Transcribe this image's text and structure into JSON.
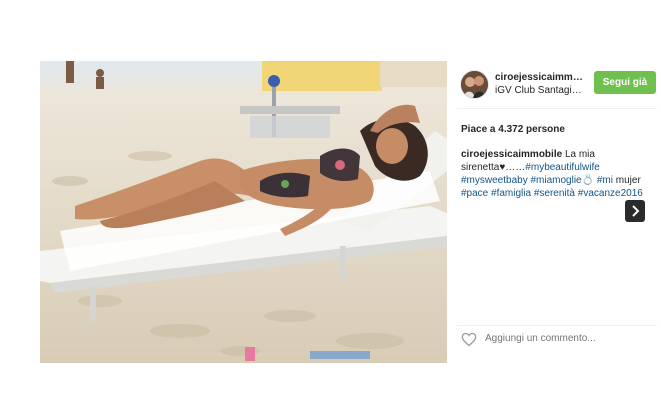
{
  "post": {
    "username": "ciroejessicaimmo…",
    "location": "iGV Club Santagiu…",
    "follow_label": "Segui già",
    "likes_text": "Piace a 4.372 persone",
    "caption": {
      "user": "ciroejessicaimmobile",
      "text1": " La mia sirenetta",
      "text2": "……",
      "tag1": "#mybeautifulwife",
      "tag2": "#mysweetbaby",
      "tag3": "#miamoglie",
      "tag4": "#mi",
      "line_text": " mujer ",
      "tag5": "#pace",
      "tag6": "#famiglia",
      "tag7": "#serenità",
      "tag8": "#vacanze2016"
    },
    "comment_placeholder": "Aggiungi un commento..."
  },
  "colors": {
    "follow_button": "#70c050",
    "hashtag": "#125688",
    "text": "#262626",
    "placeholder": "#999999"
  },
  "icons": {
    "like": "heart-outline-icon",
    "next": "chevron-right-icon"
  }
}
